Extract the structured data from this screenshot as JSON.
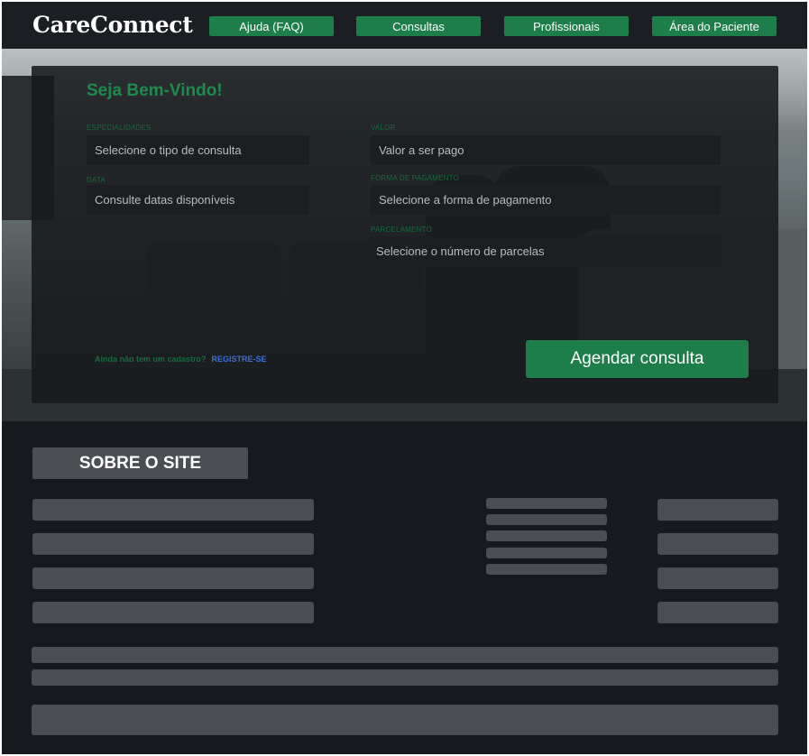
{
  "app": {
    "logo": "CareConnect"
  },
  "nav": [
    {
      "label": "Ajuda (FAQ)"
    },
    {
      "label": "Consultas"
    },
    {
      "label": "Profissionais"
    },
    {
      "label": "Área do Paciente"
    }
  ],
  "form": {
    "welcome": "Seja Bem-Vindo!",
    "specialties": {
      "label": "ESPECIALIDADES",
      "placeholder": "Selecione o tipo de consulta"
    },
    "date": {
      "label": "DATA",
      "placeholder": "Consulte datas disponíveis"
    },
    "value": {
      "label": "VALOR",
      "placeholder": "Valor a ser pago"
    },
    "payment": {
      "label": "FORMA DE PAGAMENTO",
      "placeholder": "Selecione a forma de pagamento"
    },
    "installments": {
      "label": "PARCELAMENTO",
      "placeholder": "Selecione o número de parcelas"
    },
    "signup_question": "Ainda não tem um cadastro?",
    "signup_link": "REGISTRE-SE",
    "submit": "Agendar consulta"
  },
  "about": {
    "title": "SOBRE O SITE"
  },
  "colors": {
    "accent": "#1e7e4a",
    "dark": "#16191d",
    "placeholder": "#4a4d51"
  }
}
